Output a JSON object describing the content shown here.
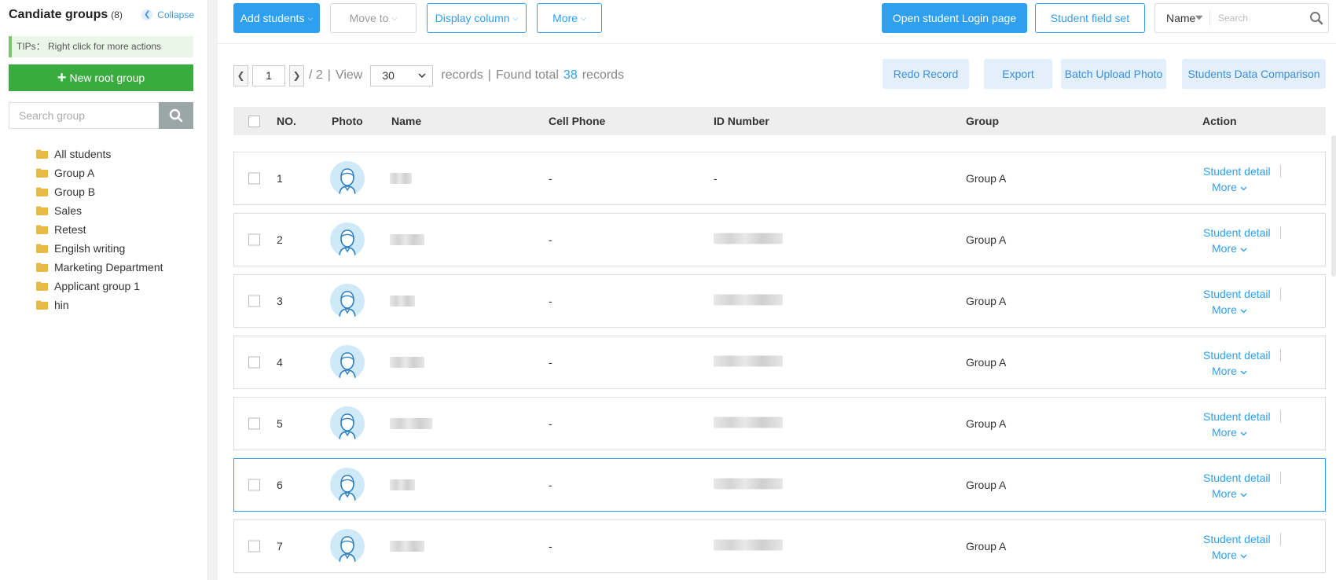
{
  "sidebar": {
    "title": "Candiate groups",
    "count": "(8)",
    "collapse_label": "Collapse",
    "tips": "TIPs： Right click for more actions",
    "new_root_label": "New root group",
    "search_placeholder": "Search group",
    "groups": [
      {
        "label": "All students"
      },
      {
        "label": "Group A"
      },
      {
        "label": "Group B"
      },
      {
        "label": "Sales"
      },
      {
        "label": "Retest"
      },
      {
        "label": "Engilsh writing"
      },
      {
        "label": "Marketing Department"
      },
      {
        "label": "Applicant group 1"
      },
      {
        "label": "hin"
      }
    ]
  },
  "toolbar": {
    "add_students": "Add students",
    "move_to": "Move to",
    "display_column": "Display column",
    "more": "More",
    "open_login": "Open student Login page",
    "field_set": "Student field set",
    "search_field": "Name",
    "search_placeholder": "Search"
  },
  "pager": {
    "current_page": "1",
    "total_pages": "/ 2",
    "view_label": "View",
    "page_size": "30",
    "records_label": "records",
    "found_label": "Found total",
    "found_count": "38",
    "records_suffix": "records"
  },
  "actions": {
    "redo": "Redo Record",
    "export": "Export",
    "batch_upload": "Batch Upload Photo",
    "comparison": "Students Data Comparison"
  },
  "table": {
    "headers": {
      "no": "NO.",
      "photo": "Photo",
      "name": "Name",
      "phone": "Cell Phone",
      "id": "ID Number",
      "group": "Group",
      "action": "Action"
    },
    "action_detail": "Student detail",
    "action_more": "More",
    "rows": [
      {
        "no": "1",
        "phone": "-",
        "id_text": "-",
        "group": "Group A",
        "selected": false,
        "name_w": 28,
        "id_w": 0
      },
      {
        "no": "2",
        "phone": "-",
        "id_text": "",
        "group": "Group A",
        "selected": false,
        "name_w": 44,
        "id_w": 88
      },
      {
        "no": "3",
        "phone": "-",
        "id_text": "",
        "group": "Group A",
        "selected": false,
        "name_w": 32,
        "id_w": 88
      },
      {
        "no": "4",
        "phone": "-",
        "id_text": "",
        "group": "Group A",
        "selected": false,
        "name_w": 44,
        "id_w": 88
      },
      {
        "no": "5",
        "phone": "-",
        "id_text": "",
        "group": "Group A",
        "selected": false,
        "name_w": 54,
        "id_w": 88
      },
      {
        "no": "6",
        "phone": "-",
        "id_text": "",
        "group": "Group A",
        "selected": true,
        "name_w": 32,
        "id_w": 88
      },
      {
        "no": "7",
        "phone": "-",
        "id_text": "",
        "group": "Group A",
        "selected": false,
        "name_w": 44,
        "id_w": 88
      }
    ]
  }
}
